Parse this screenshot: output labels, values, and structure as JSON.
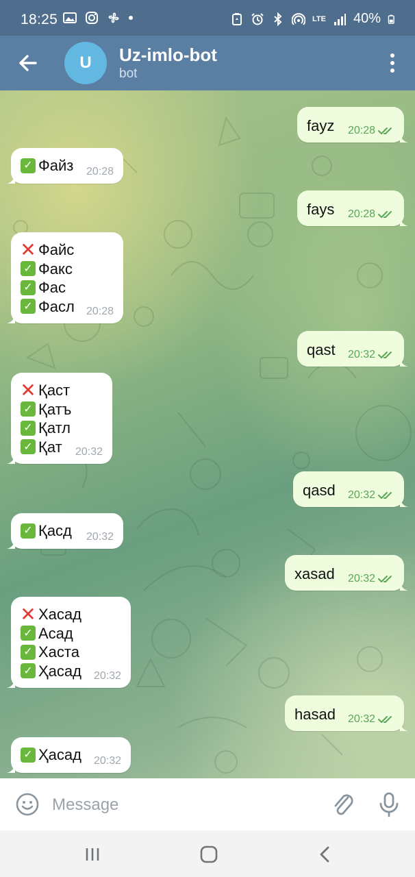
{
  "status_bar": {
    "time": "18:25",
    "battery": "40%",
    "network": "LTE"
  },
  "header": {
    "avatar_letter": "U",
    "title": "Uz-imlo-bot",
    "subtitle": "bot"
  },
  "messages": [
    {
      "dir": "out",
      "text": "fayz",
      "time": "20:28",
      "read": true
    },
    {
      "dir": "in",
      "lines": [
        {
          "mark": "ok",
          "text": "Файз"
        }
      ],
      "time": "20:28"
    },
    {
      "dir": "out",
      "text": "fays",
      "time": "20:28",
      "read": true
    },
    {
      "dir": "in",
      "lines": [
        {
          "mark": "bad",
          "text": "Файс"
        },
        {
          "mark": "ok",
          "text": "Факс"
        },
        {
          "mark": "ok",
          "text": "Фас"
        },
        {
          "mark": "ok",
          "text": "Фасл"
        }
      ],
      "time": "20:28"
    },
    {
      "dir": "out",
      "text": "qast",
      "time": "20:32",
      "read": true
    },
    {
      "dir": "in",
      "lines": [
        {
          "mark": "bad",
          "text": "Қаст"
        },
        {
          "mark": "ok",
          "text": "Қатъ"
        },
        {
          "mark": "ok",
          "text": "Қатл"
        },
        {
          "mark": "ok",
          "text": "Қат"
        }
      ],
      "time": "20:32"
    },
    {
      "dir": "out",
      "text": "qasd",
      "time": "20:32",
      "read": true
    },
    {
      "dir": "in",
      "lines": [
        {
          "mark": "ok",
          "text": "Қасд"
        }
      ],
      "time": "20:32"
    },
    {
      "dir": "out",
      "text": "xasad",
      "time": "20:32",
      "read": true
    },
    {
      "dir": "in",
      "lines": [
        {
          "mark": "bad",
          "text": "Хасад"
        },
        {
          "mark": "ok",
          "text": "Асад"
        },
        {
          "mark": "ok",
          "text": "Хаста"
        },
        {
          "mark": "ok",
          "text": "Ҳасад"
        }
      ],
      "time": "20:32"
    },
    {
      "dir": "out",
      "text": "hasad",
      "time": "20:32",
      "read": true
    },
    {
      "dir": "in",
      "lines": [
        {
          "mark": "ok",
          "text": "Ҳасад"
        }
      ],
      "time": "20:32"
    }
  ],
  "input": {
    "placeholder": "Message"
  },
  "colors": {
    "header": "#5b7fa3",
    "status_bar": "#4f6e8d",
    "outgoing_bubble": "#effdde",
    "incoming_bubble": "#ffffff",
    "read_tick": "#5aa657",
    "ok_mark": "#69b83c",
    "bad_mark": "#e23a32"
  },
  "icons": [
    "back-arrow-icon",
    "more-vert-icon",
    "emoji-icon",
    "attach-icon",
    "mic-icon",
    "recents-icon",
    "home-icon",
    "back-icon"
  ]
}
